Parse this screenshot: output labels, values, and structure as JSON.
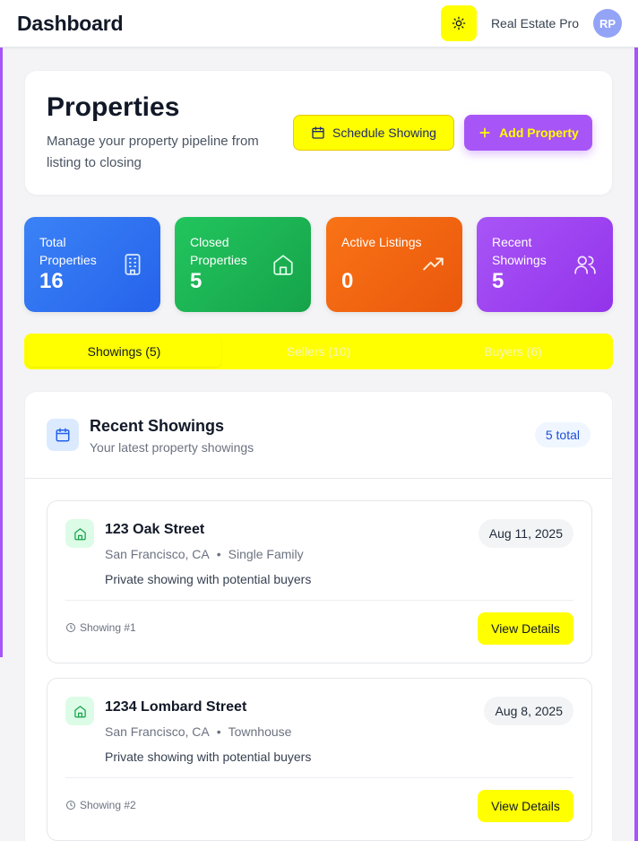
{
  "topbar": {
    "title": "Dashboard",
    "theme_icon": "sun-icon",
    "org_name": "Real Estate Pro",
    "avatar_initials": "RP"
  },
  "header": {
    "title": "Properties",
    "subtitle": "Manage your property pipeline from listing to closing",
    "schedule_label": "Schedule Showing",
    "add_label": "Add Property"
  },
  "stats": [
    {
      "label": "Total Properties",
      "value": "16",
      "icon": "building-icon",
      "color": "#2563eb"
    },
    {
      "label": "Closed Properties",
      "value": "5",
      "icon": "home-icon",
      "color": "#16a34a"
    },
    {
      "label": "Active Listings",
      "value": "0",
      "icon": "trending-up-icon",
      "color": "#ea580c"
    },
    {
      "label": "Recent Showings",
      "value": "5",
      "icon": "users-icon",
      "color": "#9333ea"
    }
  ],
  "tabs": [
    {
      "label": "Showings (5)",
      "active": true
    },
    {
      "label": "Sellers (10)",
      "active": false
    },
    {
      "label": "Buyers (6)",
      "active": false
    }
  ],
  "showings_panel": {
    "title": "Recent Showings",
    "subtitle": "Your latest property showings",
    "total_badge": "5 total",
    "items": [
      {
        "address": "123 Oak Street",
        "city": "San Francisco, CA",
        "type": "Single Family",
        "note": "Private showing with potential buyers",
        "date": "Aug 11, 2025",
        "number": "Showing #1",
        "action": "View Details"
      },
      {
        "address": "1234 Lombard Street",
        "city": "San Francisco, CA",
        "type": "Townhouse",
        "note": "Private showing with potential buyers",
        "date": "Aug 8, 2025",
        "number": "Showing #2",
        "action": "View Details"
      }
    ]
  },
  "colors": {
    "accent_yellow": "#ffff00",
    "accent_purple": "#a855f7"
  }
}
